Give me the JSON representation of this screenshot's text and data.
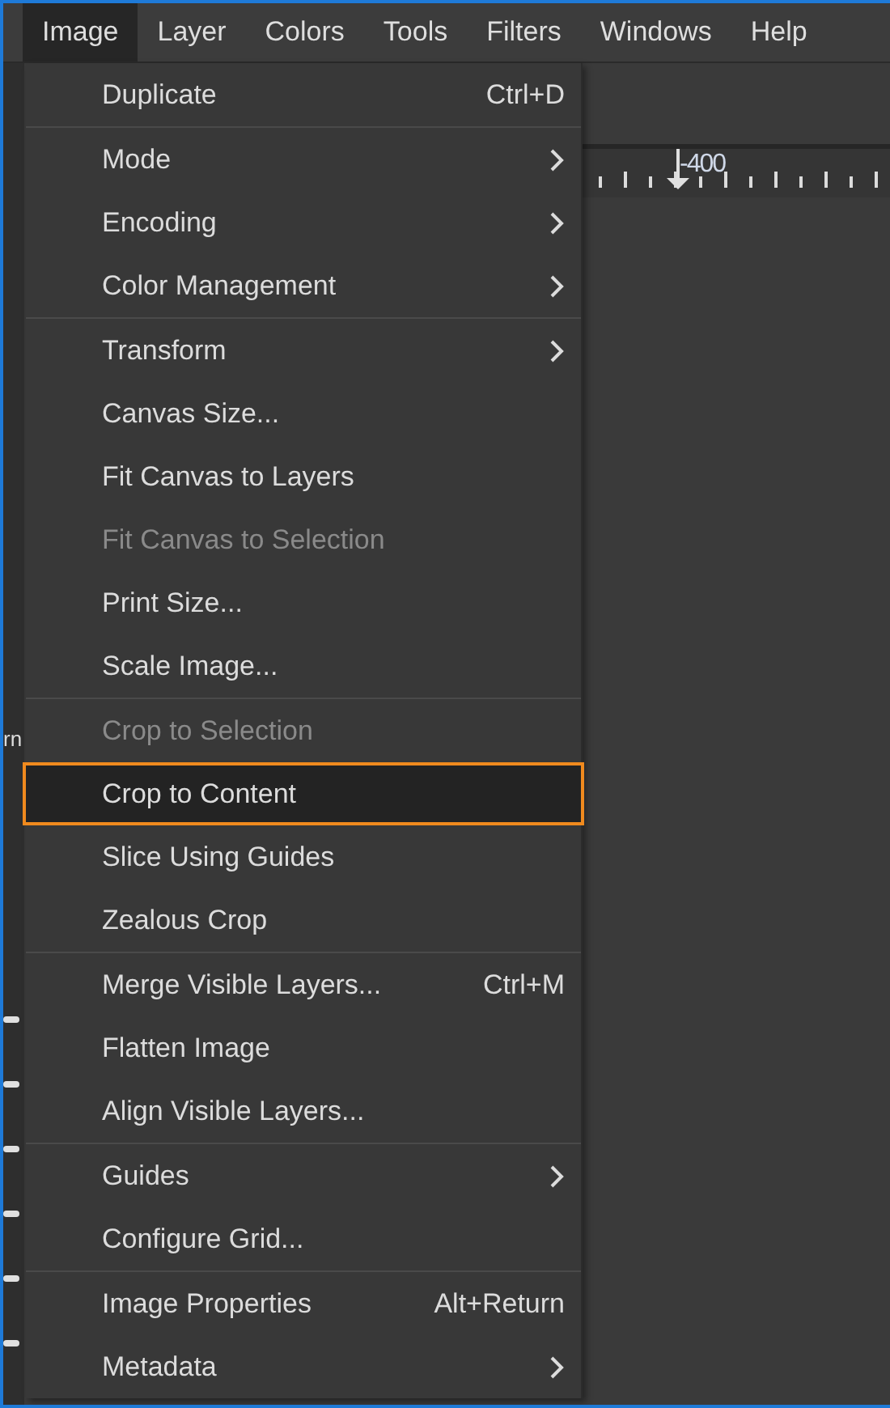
{
  "menu_bar": [
    {
      "label": "Image",
      "selected": true
    },
    {
      "label": "Layer",
      "selected": false
    },
    {
      "label": "Colors",
      "selected": false
    },
    {
      "label": "Tools",
      "selected": false
    },
    {
      "label": "Filters",
      "selected": false
    },
    {
      "label": "Windows",
      "selected": false
    },
    {
      "label": "Help",
      "selected": false
    }
  ],
  "side_panel": {
    "label": "rn"
  },
  "ruler": {
    "label": "-400"
  },
  "menu": {
    "sections": [
      [
        {
          "label": "Duplicate",
          "shortcut": "Ctrl+D",
          "submenu": false,
          "disabled": false,
          "selected": false
        }
      ],
      [
        {
          "label": "Mode",
          "submenu": true,
          "disabled": false,
          "selected": false
        },
        {
          "label": "Encoding",
          "submenu": true,
          "disabled": false,
          "selected": false
        },
        {
          "label": "Color Management",
          "submenu": true,
          "disabled": false,
          "selected": false
        }
      ],
      [
        {
          "label": "Transform",
          "submenu": true,
          "disabled": false,
          "selected": false
        },
        {
          "label": "Canvas Size...",
          "submenu": false,
          "disabled": false,
          "selected": false
        },
        {
          "label": "Fit Canvas to Layers",
          "submenu": false,
          "disabled": false,
          "selected": false
        },
        {
          "label": "Fit Canvas to Selection",
          "submenu": false,
          "disabled": true,
          "selected": false
        },
        {
          "label": "Print Size...",
          "submenu": false,
          "disabled": false,
          "selected": false
        },
        {
          "label": "Scale Image...",
          "submenu": false,
          "disabled": false,
          "selected": false
        }
      ],
      [
        {
          "label": "Crop to Selection",
          "submenu": false,
          "disabled": true,
          "selected": false
        },
        {
          "label": "Crop to Content",
          "submenu": false,
          "disabled": false,
          "selected": true
        },
        {
          "label": "Slice Using Guides",
          "submenu": false,
          "disabled": false,
          "selected": false
        },
        {
          "label": "Zealous Crop",
          "submenu": false,
          "disabled": false,
          "selected": false
        }
      ],
      [
        {
          "label": "Merge Visible Layers...",
          "shortcut": "Ctrl+M",
          "submenu": false,
          "disabled": false,
          "selected": false
        },
        {
          "label": "Flatten Image",
          "submenu": false,
          "disabled": false,
          "selected": false
        },
        {
          "label": "Align Visible Layers...",
          "submenu": false,
          "disabled": false,
          "selected": false
        }
      ],
      [
        {
          "label": "Guides",
          "submenu": true,
          "disabled": false,
          "selected": false
        },
        {
          "label": "Configure Grid...",
          "submenu": false,
          "disabled": false,
          "selected": false
        }
      ],
      [
        {
          "label": "Image Properties",
          "shortcut": "Alt+Return",
          "submenu": false,
          "disabled": false,
          "selected": false
        },
        {
          "label": "Metadata",
          "submenu": true,
          "disabled": false,
          "selected": false
        }
      ]
    ]
  }
}
